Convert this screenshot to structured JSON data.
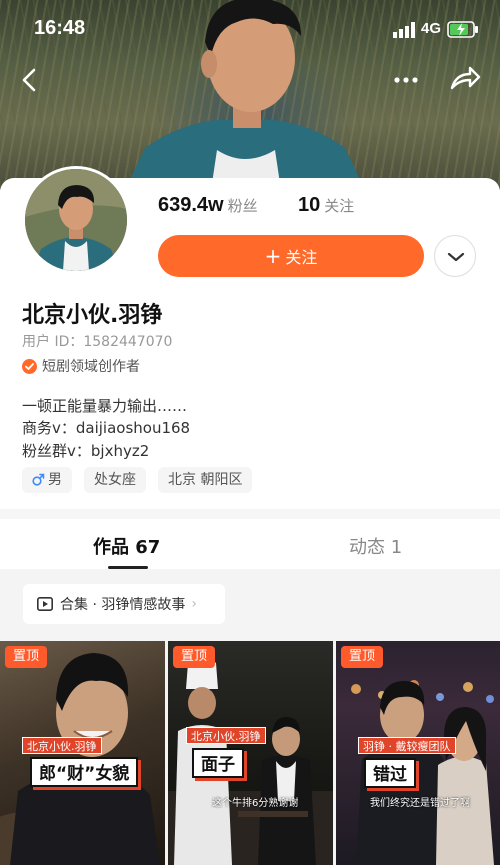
{
  "status_bar": {
    "time": "16:48",
    "network": "4G",
    "icons": [
      "signal-icon",
      "battery-charging-icon"
    ]
  },
  "nav": {
    "icons": [
      "back-arrow-icon",
      "more-dots-icon",
      "share-icon"
    ]
  },
  "stats": {
    "fans_value": "639.4w",
    "fans_label": "粉丝",
    "following_value": "10",
    "following_label": "关注"
  },
  "follow_button": {
    "label": "关注",
    "icon": "plus-icon",
    "color": "#ff6a2b"
  },
  "profile": {
    "name": "北京小伙.羽铮",
    "user_id_label": "用户 ID：",
    "user_id": "1582447070",
    "creator_badge": "短剧领域创作者",
    "bio": [
      "一顿正能量暴力输出……",
      "商务v：daijiaoshou168",
      "粉丝群v：bjxhyz2"
    ],
    "tags": [
      "男",
      "处女座",
      "北京 朝阳区"
    ]
  },
  "tabs": [
    {
      "label": "作品 67",
      "active": true
    },
    {
      "label": "动态 1",
      "active": false
    }
  ],
  "collection": {
    "label": "合集 · 羽铮情感故事",
    "arrow": "›"
  },
  "videos": [
    {
      "pin": "置顶",
      "tag": "北京小伙.羽铮",
      "title": "郎“财”女貌",
      "subtitle": ""
    },
    {
      "pin": "置顶",
      "tag": "北京小伙.羽铮",
      "title": "面子",
      "subtitle": "这个牛排6分熟谢谢"
    },
    {
      "pin": "置顶",
      "tag": "羽铮 · 戴较瘦团队",
      "title": "错过",
      "subtitle": "我们终究还是错过了啊"
    }
  ],
  "accent_color": "#ff5a2b"
}
